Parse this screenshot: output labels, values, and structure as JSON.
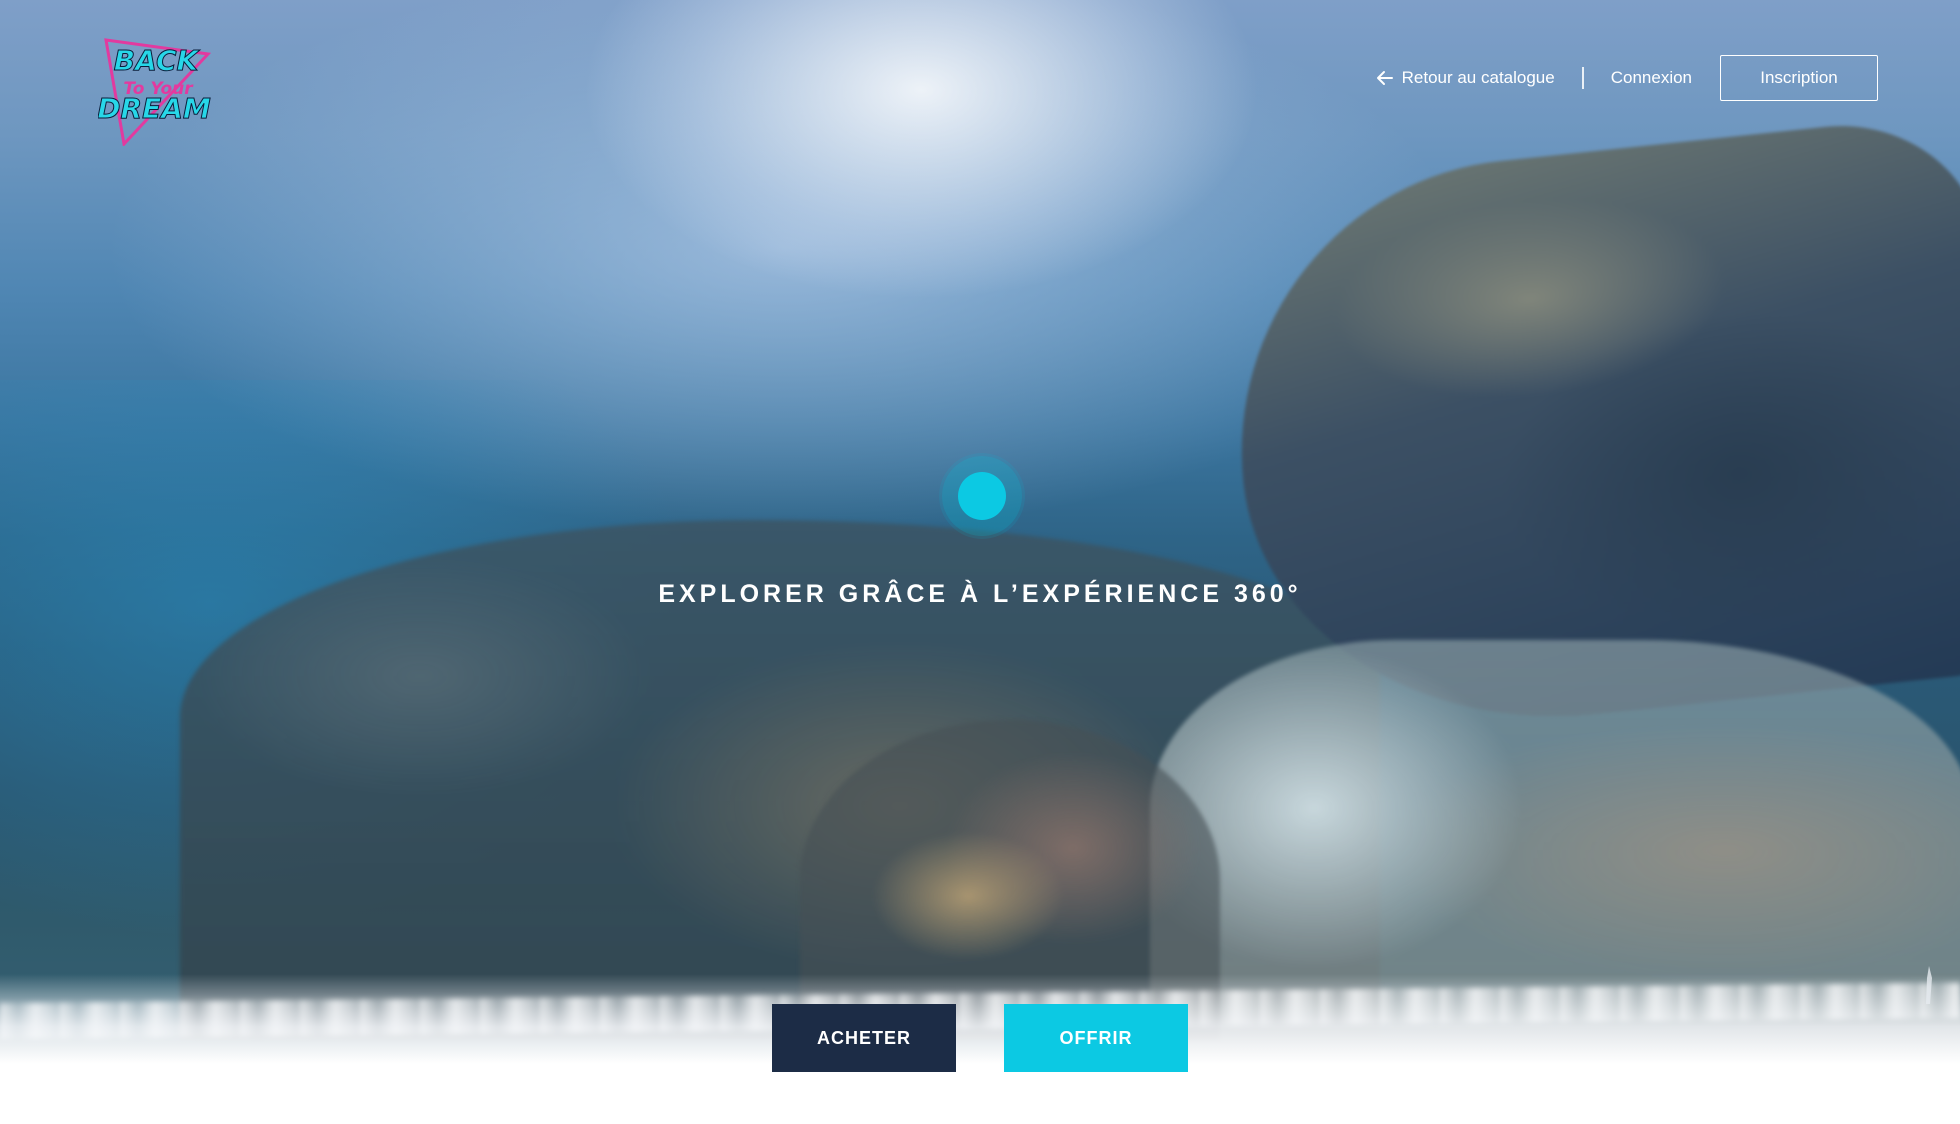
{
  "header": {
    "logo": {
      "alt": "Back to your dream",
      "line1": "BACK",
      "line2": "To Your",
      "line3": "DREAM",
      "colors": {
        "cyan": "#27d7e8",
        "magenta": "#e23a9f",
        "dark": "#0b1d3a"
      }
    },
    "nav": {
      "back_label": "Retour au catalogue",
      "back_icon": "arrow-left-icon",
      "login_label": "Connexion",
      "signup_label": "Inscription"
    }
  },
  "hero": {
    "headline": "EXPLORER GRÂCE À L’EXPÉRIENCE 360°",
    "indicator_icon": "360-pulse-icon"
  },
  "actions": {
    "buy_label": "ACHETER",
    "gift_label": "OFFRIR"
  },
  "colors": {
    "accent": "#0cc9e3",
    "buy_button": "#1c2c46",
    "text": "#ffffff"
  }
}
